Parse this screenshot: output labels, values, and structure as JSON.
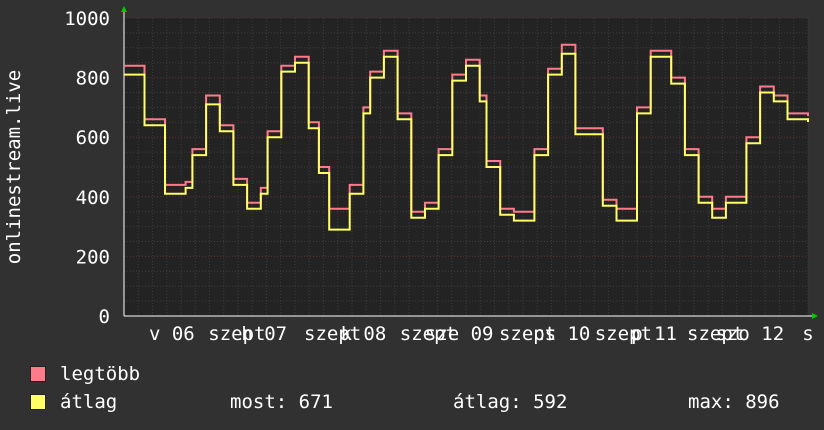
{
  "colors": {
    "background": "#313131",
    "plot_bg": "#232323",
    "grid_minor": "#3d3d3d",
    "grid_major": "#5a2a2a",
    "axis": "#ffffff",
    "arrow": "#00cc00",
    "series_max": "#ff7b8a",
    "series_avg": "#ffff66"
  },
  "legend": {
    "max_label": "legtöbb",
    "avg_label": "átlag",
    "current": "most: 671",
    "average": "átlag: 592",
    "maximum": "max: 896"
  },
  "chart_data": {
    "type": "line",
    "ylabel": "onlinestream.live",
    "ylim": [
      0,
      1000
    ],
    "yticks": [
      0,
      200,
      400,
      600,
      800,
      1000
    ],
    "xlim": [
      0,
      1
    ],
    "xtick_labels": [
      {
        "pos": 0.07,
        "text": "v 06"
      },
      {
        "pos": 0.165,
        "text": "szept"
      },
      {
        "pos": 0.205,
        "text": "h 07"
      },
      {
        "pos": 0.305,
        "text": "szept"
      },
      {
        "pos": 0.35,
        "text": "k 08"
      },
      {
        "pos": 0.445,
        "text": "szept"
      },
      {
        "pos": 0.49,
        "text": "sze 09"
      },
      {
        "pos": 0.59,
        "text": "szept"
      },
      {
        "pos": 0.64,
        "text": "cs 10"
      },
      {
        "pos": 0.73,
        "text": "szept"
      },
      {
        "pos": 0.775,
        "text": "p 11"
      },
      {
        "pos": 0.865,
        "text": "szept"
      },
      {
        "pos": 0.915,
        "text": "szo 12"
      },
      {
        "pos": 1.0,
        "text": "s"
      }
    ],
    "x": [
      0.0,
      0.03,
      0.06,
      0.09,
      0.1,
      0.12,
      0.14,
      0.16,
      0.18,
      0.2,
      0.21,
      0.23,
      0.25,
      0.27,
      0.285,
      0.3,
      0.33,
      0.35,
      0.36,
      0.38,
      0.4,
      0.42,
      0.44,
      0.46,
      0.48,
      0.5,
      0.52,
      0.53,
      0.55,
      0.57,
      0.6,
      0.62,
      0.64,
      0.66,
      0.7,
      0.72,
      0.75,
      0.77,
      0.8,
      0.82,
      0.84,
      0.86,
      0.88,
      0.91,
      0.93,
      0.95,
      0.97,
      1.0
    ],
    "series": [
      {
        "name": "legtöbb",
        "color": "#ff7b8a",
        "values": [
          840,
          660,
          440,
          450,
          560,
          740,
          640,
          460,
          380,
          430,
          620,
          840,
          870,
          650,
          500,
          360,
          440,
          700,
          820,
          890,
          680,
          350,
          380,
          560,
          810,
          860,
          740,
          520,
          360,
          350,
          560,
          830,
          910,
          630,
          390,
          360,
          700,
          890,
          800,
          560,
          400,
          360,
          400,
          600,
          770,
          740,
          680,
          671
        ]
      },
      {
        "name": "átlag",
        "color": "#ffff66",
        "values": [
          810,
          640,
          410,
          430,
          540,
          710,
          620,
          440,
          360,
          410,
          600,
          820,
          850,
          630,
          480,
          290,
          410,
          680,
          800,
          870,
          660,
          330,
          360,
          540,
          790,
          840,
          720,
          500,
          340,
          320,
          540,
          810,
          880,
          610,
          370,
          320,
          680,
          870,
          780,
          540,
          380,
          330,
          380,
          580,
          750,
          720,
          660,
          651
        ]
      }
    ]
  }
}
